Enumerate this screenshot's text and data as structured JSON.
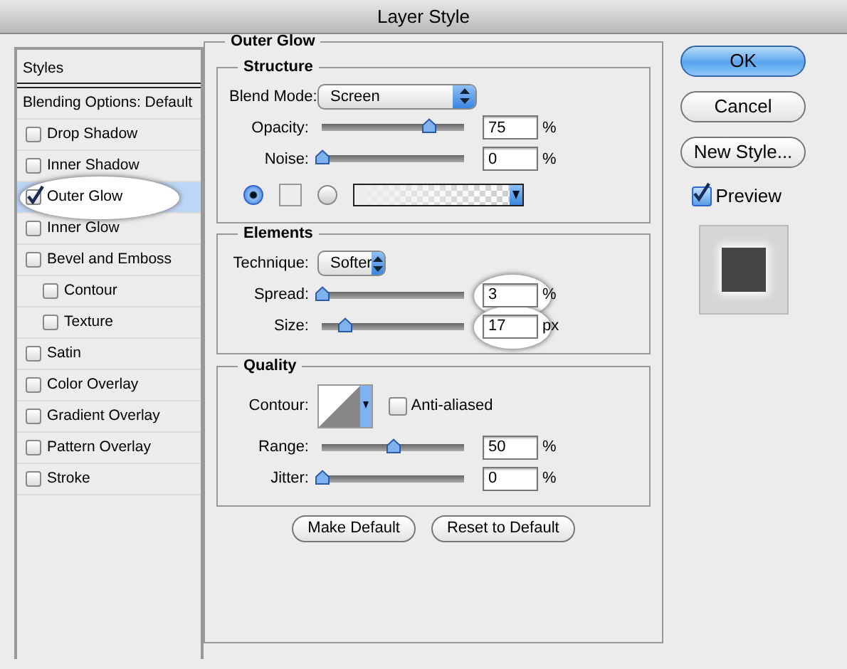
{
  "window": {
    "title": "Layer Style"
  },
  "styles_list": {
    "header": "Styles",
    "items": [
      {
        "kind": "plain",
        "label": "Blending Options: Default",
        "selected": false,
        "highlighted": false
      },
      {
        "kind": "check",
        "label": "Drop Shadow",
        "checked": false,
        "selected": false,
        "highlighted": false
      },
      {
        "kind": "check",
        "label": "Inner Shadow",
        "checked": false,
        "selected": false,
        "highlighted": false
      },
      {
        "kind": "check",
        "label": "Outer Glow",
        "checked": true,
        "selected": true,
        "highlighted": true
      },
      {
        "kind": "check",
        "label": "Inner Glow",
        "checked": false,
        "selected": false,
        "highlighted": false
      },
      {
        "kind": "check",
        "label": "Bevel and Emboss",
        "checked": false,
        "selected": false,
        "highlighted": false,
        "children": [
          {
            "kind": "check",
            "label": "Contour",
            "checked": false,
            "selected": false,
            "highlighted": false
          },
          {
            "kind": "check",
            "label": "Texture",
            "checked": false,
            "selected": false,
            "highlighted": false
          }
        ]
      },
      {
        "kind": "check",
        "label": "Satin",
        "checked": false,
        "selected": false,
        "highlighted": false
      },
      {
        "kind": "check",
        "label": "Color Overlay",
        "checked": false,
        "selected": false,
        "highlighted": false
      },
      {
        "kind": "check",
        "label": "Gradient Overlay",
        "checked": false,
        "selected": false,
        "highlighted": false
      },
      {
        "kind": "check",
        "label": "Pattern Overlay",
        "checked": false,
        "selected": false,
        "highlighted": false
      },
      {
        "kind": "check",
        "label": "Stroke",
        "checked": false,
        "selected": false,
        "highlighted": false
      }
    ]
  },
  "panel": {
    "title": "Outer Glow",
    "structure": {
      "title": "Structure",
      "blend_mode": {
        "label": "Blend Mode:",
        "value": "Screen"
      },
      "sliders": [
        {
          "label": "Opacity:",
          "level": 0.75,
          "value": "75",
          "unit": "%",
          "highlighted": false
        },
        {
          "label": "Noise:",
          "level": 0,
          "value": "0",
          "unit": "%",
          "highlighted": false
        }
      ],
      "fill": [
        {
          "kind": "color",
          "selected": true
        },
        {
          "kind": "gradient",
          "selected": false
        }
      ]
    },
    "elements": {
      "title": "Elements",
      "technique": {
        "label": "Technique:",
        "value": "Softer"
      },
      "sliders": [
        {
          "label": "Spread:",
          "level": 0,
          "value": "3",
          "unit": "%",
          "highlighted": true
        },
        {
          "label": "Size:",
          "level": 0.16,
          "value": "17",
          "unit": "px",
          "highlighted": true
        }
      ]
    },
    "quality": {
      "title": "Quality",
      "contour": {
        "label": "Contour:"
      },
      "anti_aliased": {
        "label": "Anti-aliased",
        "checked": false
      },
      "sliders": [
        {
          "label": "Range:",
          "level": 0.5,
          "value": "50",
          "unit": "%",
          "highlighted": false
        },
        {
          "label": "Jitter:",
          "level": 0,
          "value": "0",
          "unit": "%",
          "highlighted": false
        }
      ]
    },
    "buttons": [
      "Make Default",
      "Reset to Default"
    ]
  },
  "actions": [
    {
      "label": "OK",
      "default": true
    },
    {
      "label": "Cancel",
      "default": false
    },
    {
      "label": "New Style...",
      "default": false
    }
  ],
  "preview": {
    "label": "Preview",
    "checked": true
  }
}
